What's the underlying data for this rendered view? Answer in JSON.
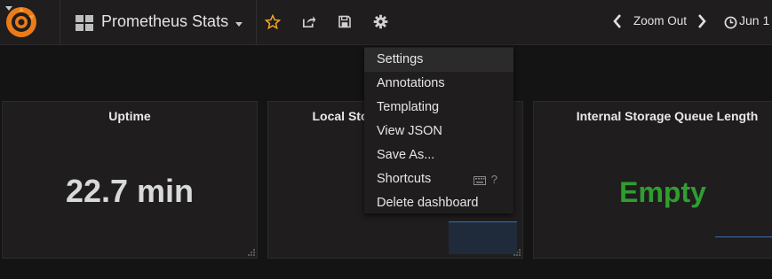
{
  "navbar": {
    "dashboard_title": "Prometheus Stats",
    "zoom_label": "Zoom Out",
    "time_range": "Jun 1",
    "accent_color": "#eb7b18",
    "star_color": "#f5a623"
  },
  "panels": [
    {
      "title": "Uptime",
      "value": "22.7 min"
    },
    {
      "title": "Local Sto"
    },
    {
      "title": "Internal Storage Queue Length",
      "value": "Empty",
      "value_color": "#2f9e2f"
    }
  ],
  "settings_menu": {
    "items": [
      {
        "label": "Settings"
      },
      {
        "label": "Annotations"
      },
      {
        "label": "Templating"
      },
      {
        "label": "View JSON"
      },
      {
        "label": "Save As..."
      },
      {
        "label": "Shortcuts",
        "hint": "?"
      },
      {
        "label": "Delete dashboard"
      }
    ]
  }
}
